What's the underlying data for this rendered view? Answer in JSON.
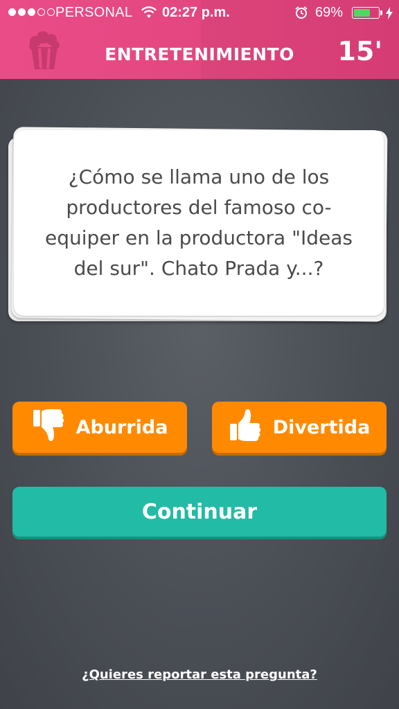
{
  "status_bar": {
    "signal_filled": 3,
    "signal_total": 5,
    "carrier": "PERSONAL",
    "time": "02:27 p.m.",
    "battery_percent": "69%",
    "battery_level": 0.69,
    "icons": [
      "wifi-icon",
      "alarm-icon",
      "battery-icon",
      "charging-bolt-icon"
    ]
  },
  "header": {
    "category_icon": "popcorn-icon",
    "category": "ENTRETENIMIENTO",
    "timer": "15'"
  },
  "question": {
    "text": "¿Cómo se llama uno de los productores del famoso co-equiper en la productora \"Ideas del sur\". Chato Prada y...?"
  },
  "buttons": {
    "boring": {
      "label": "Aburrida",
      "icon": "thumbs-down-icon"
    },
    "fun": {
      "label": "Divertida",
      "icon": "thumbs-up-icon"
    },
    "continue": {
      "label": "Continuar"
    }
  },
  "report_link": "¿Quieres reportar esta pregunta?",
  "colors": {
    "header": "#e84a85",
    "background": "#4e5258",
    "orange": "#ff8a00",
    "teal": "#22bba5",
    "battery_fill": "#4cd964"
  }
}
